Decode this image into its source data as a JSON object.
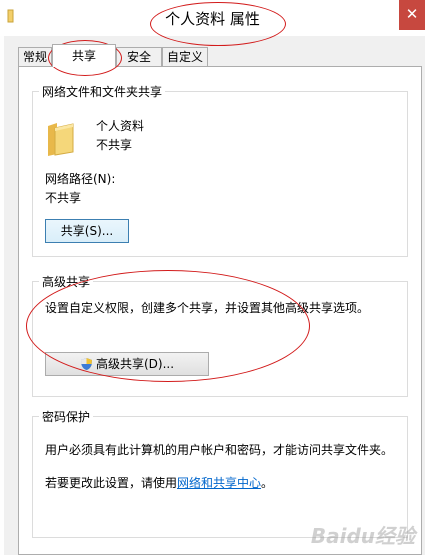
{
  "window": {
    "title": "个人资料 属性",
    "close_glyph": "✕"
  },
  "tabs": [
    {
      "label": "常规",
      "active": false
    },
    {
      "label": "共享",
      "active": true
    },
    {
      "label": "安全",
      "active": false
    },
    {
      "label": "自定义",
      "active": false
    }
  ],
  "network_share": {
    "group_title": "网络文件和文件夹共享",
    "folder_name": "个人资料",
    "folder_status": "不共享",
    "path_label": "网络路径(N):",
    "path_value": "不共享",
    "share_button": "共享(S)..."
  },
  "advanced_share": {
    "group_title": "高级共享",
    "description": "设置自定义权限，创建多个共享，并设置其他高级共享选项。",
    "button": "高级共享(D)..."
  },
  "password_protect": {
    "group_title": "密码保护",
    "description": "用户必须具有此计算机的用户帐户和密码，才能访问共享文件夹。",
    "change_prefix": "若要更改此设置，请使用",
    "change_link": "网络和共享中心",
    "change_suffix": "。"
  },
  "watermark": "Baidu经验",
  "colors": {
    "folder": "#f3cf6a",
    "close": "#c7483f",
    "annotation": "#d21b1b",
    "link": "#0066cc"
  }
}
